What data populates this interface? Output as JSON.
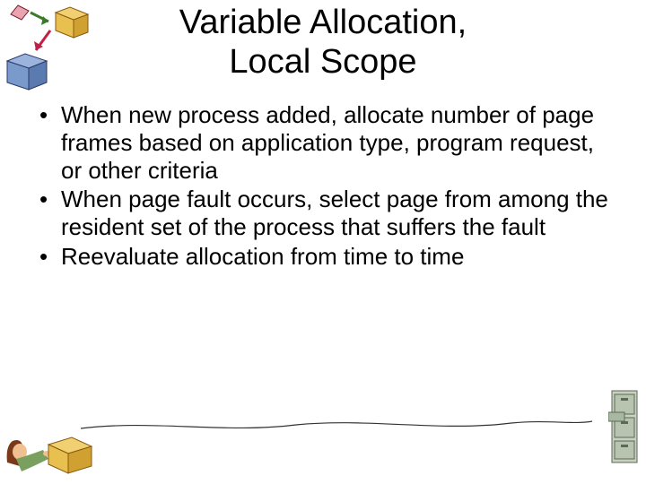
{
  "title_line1": "Variable Allocation,",
  "title_line2": "Local Scope",
  "bullets": [
    "When new process added, allocate number of page frames based on application type, program request, or other criteria",
    "When page fault occurs, select page from among the resident set of the process that suffers the fault",
    "Reevaluate allocation from time to time"
  ]
}
